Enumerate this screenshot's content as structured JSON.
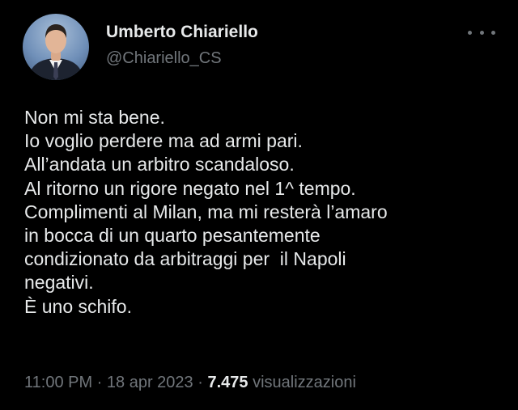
{
  "author": {
    "display_name": "Umberto Chiariello",
    "handle": "@Chiariello_CS"
  },
  "tweet": {
    "lines": [
      "Non mi sta bene.",
      "Io voglio perdere ma ad armi pari.",
      "All’andata un arbitro scandaloso.",
      "Al ritorno un rigore negato nel 1^ tempo.",
      "Complimenti al Milan, ma mi resterà l’amaro",
      "in bocca di un quarto pesantemente",
      "condizionato da arbitraggi per  il Napoli",
      "negativi.",
      "È uno schifo."
    ]
  },
  "meta": {
    "time": "11:00 PM",
    "separator": " · ",
    "date": "18 apr 2023",
    "views_count": "7.475",
    "views_label": " visualizzazioni"
  },
  "icons": {
    "more": "more-horizontal-icon"
  },
  "colors": {
    "background": "#000000",
    "primary_text": "#e7e9ea",
    "secondary_text": "#71767b"
  }
}
